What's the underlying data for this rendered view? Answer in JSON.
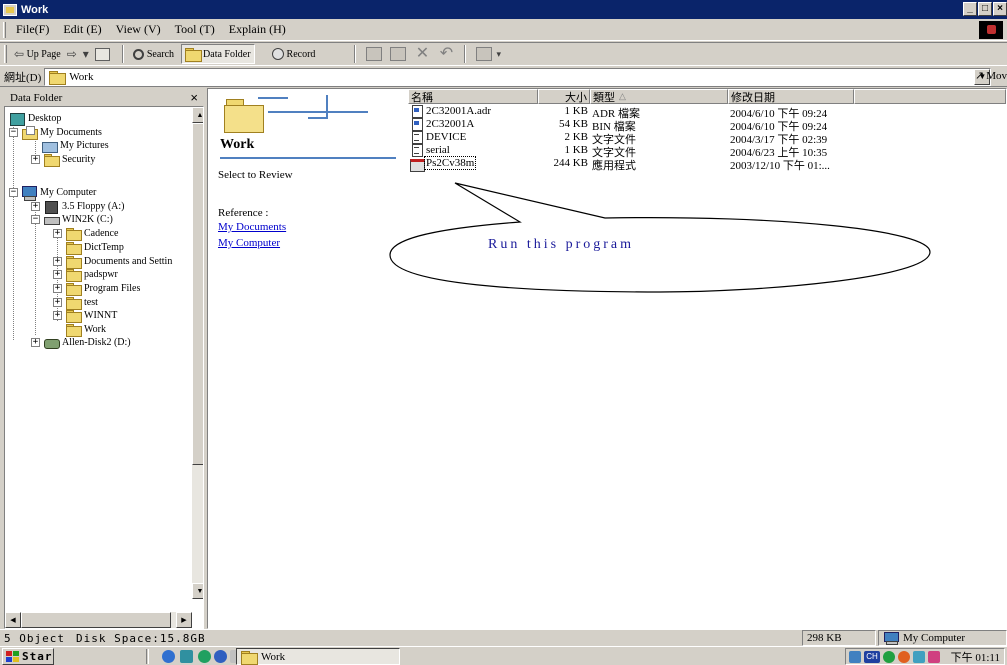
{
  "window": {
    "title": "Work",
    "buttons": [
      "_",
      "□",
      "×"
    ]
  },
  "menubar": {
    "items": [
      "File(F)",
      "Edit (E)",
      "View (V)",
      "Tool (T)",
      "Explain (H)"
    ]
  },
  "toolbar": {
    "up_page": "Up Page",
    "search": "Search",
    "data_folder": "Data Folder",
    "record": "Record"
  },
  "address": {
    "label": "網址(D)",
    "value": "Work",
    "go": "Mov"
  },
  "folder_pane": {
    "title": "Data Folder",
    "close": "×",
    "tree": [
      {
        "label": "Desktop",
        "icon": "desktop-icon"
      },
      {
        "label": "My Documents",
        "icon": "my-documents-icon"
      },
      {
        "label": "My Pictures",
        "icon": "my-pictures-icon"
      },
      {
        "label": "Security",
        "icon": "folder-icon"
      },
      {
        "label": "My Computer",
        "icon": "computer-icon"
      },
      {
        "label": "3.5 Floppy (A:)",
        "icon": "floppy-icon"
      },
      {
        "label": "WIN2K (C:)",
        "icon": "drive-icon"
      },
      {
        "label": "Cadence",
        "icon": "folder-icon"
      },
      {
        "label": "DictTemp",
        "icon": "folder-icon"
      },
      {
        "label": "Documents and Settin",
        "icon": "folder-icon"
      },
      {
        "label": "padspwr",
        "icon": "folder-icon"
      },
      {
        "label": "Program Files",
        "icon": "folder-icon"
      },
      {
        "label": "test",
        "icon": "folder-icon"
      },
      {
        "label": "WINNT",
        "icon": "folder-icon"
      },
      {
        "label": "Work",
        "icon": "open-folder-icon"
      },
      {
        "label": "Allen-Disk2 (D:)",
        "icon": "network-drive-icon"
      }
    ]
  },
  "webview": {
    "title": "Work",
    "select_text": "Select to Review",
    "reference": "Reference :",
    "links": [
      "My Documents",
      "My Computer"
    ]
  },
  "list": {
    "columns": [
      "名稱",
      "大小",
      "類型",
      "修改日期"
    ],
    "sort_indicator": "△",
    "rows": [
      {
        "name": "2C32001A.adr",
        "size": "1 KB",
        "type": "ADR 檔案",
        "date": "2004/6/10 下午 09:24",
        "icon": "file"
      },
      {
        "name": "2C32001A",
        "size": "54 KB",
        "type": "BIN 檔案",
        "date": "2004/6/10 下午 09:24",
        "icon": "file"
      },
      {
        "name": "DEVICE",
        "size": "2 KB",
        "type": "文字文件",
        "date": "2004/3/17 下午 02:39",
        "icon": "txt"
      },
      {
        "name": "serial",
        "size": "1 KB",
        "type": "文字文件",
        "date": "2004/6/23 上午 10:35",
        "icon": "txt"
      },
      {
        "name": "Ps2Cv38m",
        "size": "244 KB",
        "type": "應用程式",
        "date": "2003/12/10 下午 01:...",
        "icon": "exe"
      }
    ]
  },
  "callout": {
    "text": "Run this program"
  },
  "statusbar": {
    "objects": "5 Object",
    "disk": "Disk Space:15.8GB",
    "size": "298 KB",
    "zone": "My Computer"
  },
  "taskbar": {
    "start": "Star",
    "task": "Work",
    "ime": "CH",
    "clock": "下午 01:11"
  }
}
